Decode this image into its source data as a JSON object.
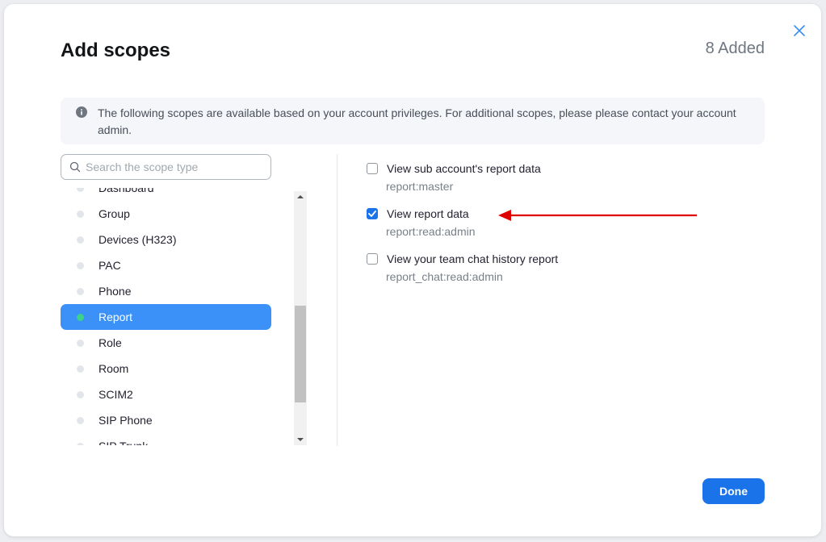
{
  "dialog": {
    "title": "Add scopes",
    "added_count": "8 Added",
    "notice": "The following scopes are available based on your account privileges. For additional scopes, please please contact your account admin.",
    "close_icon": "close-icon",
    "done_label": "Done"
  },
  "search": {
    "placeholder": "Search the scope type",
    "value": ""
  },
  "scope_types": [
    {
      "label": "Dashboard",
      "selected": false
    },
    {
      "label": "Group",
      "selected": false
    },
    {
      "label": "Devices (H323)",
      "selected": false
    },
    {
      "label": "PAC",
      "selected": false
    },
    {
      "label": "Phone",
      "selected": false
    },
    {
      "label": "Report",
      "selected": true
    },
    {
      "label": "Role",
      "selected": false
    },
    {
      "label": "Room",
      "selected": false
    },
    {
      "label": "SCIM2",
      "selected": false
    },
    {
      "label": "SIP Phone",
      "selected": false
    },
    {
      "label": "SIP Trunk",
      "selected": false
    }
  ],
  "scopes": [
    {
      "name": "View sub account's report data",
      "key": "report:master",
      "checked": false
    },
    {
      "name": "View report data",
      "key": "report:read:admin",
      "checked": true
    },
    {
      "name": "View your team chat history report",
      "key": "report_chat:read:admin",
      "checked": false
    }
  ],
  "colors": {
    "accent": "#1a73e8",
    "selected_item": "#3b91f7",
    "selected_dot": "#3bd28a",
    "annotation_arrow": "#e00000"
  }
}
